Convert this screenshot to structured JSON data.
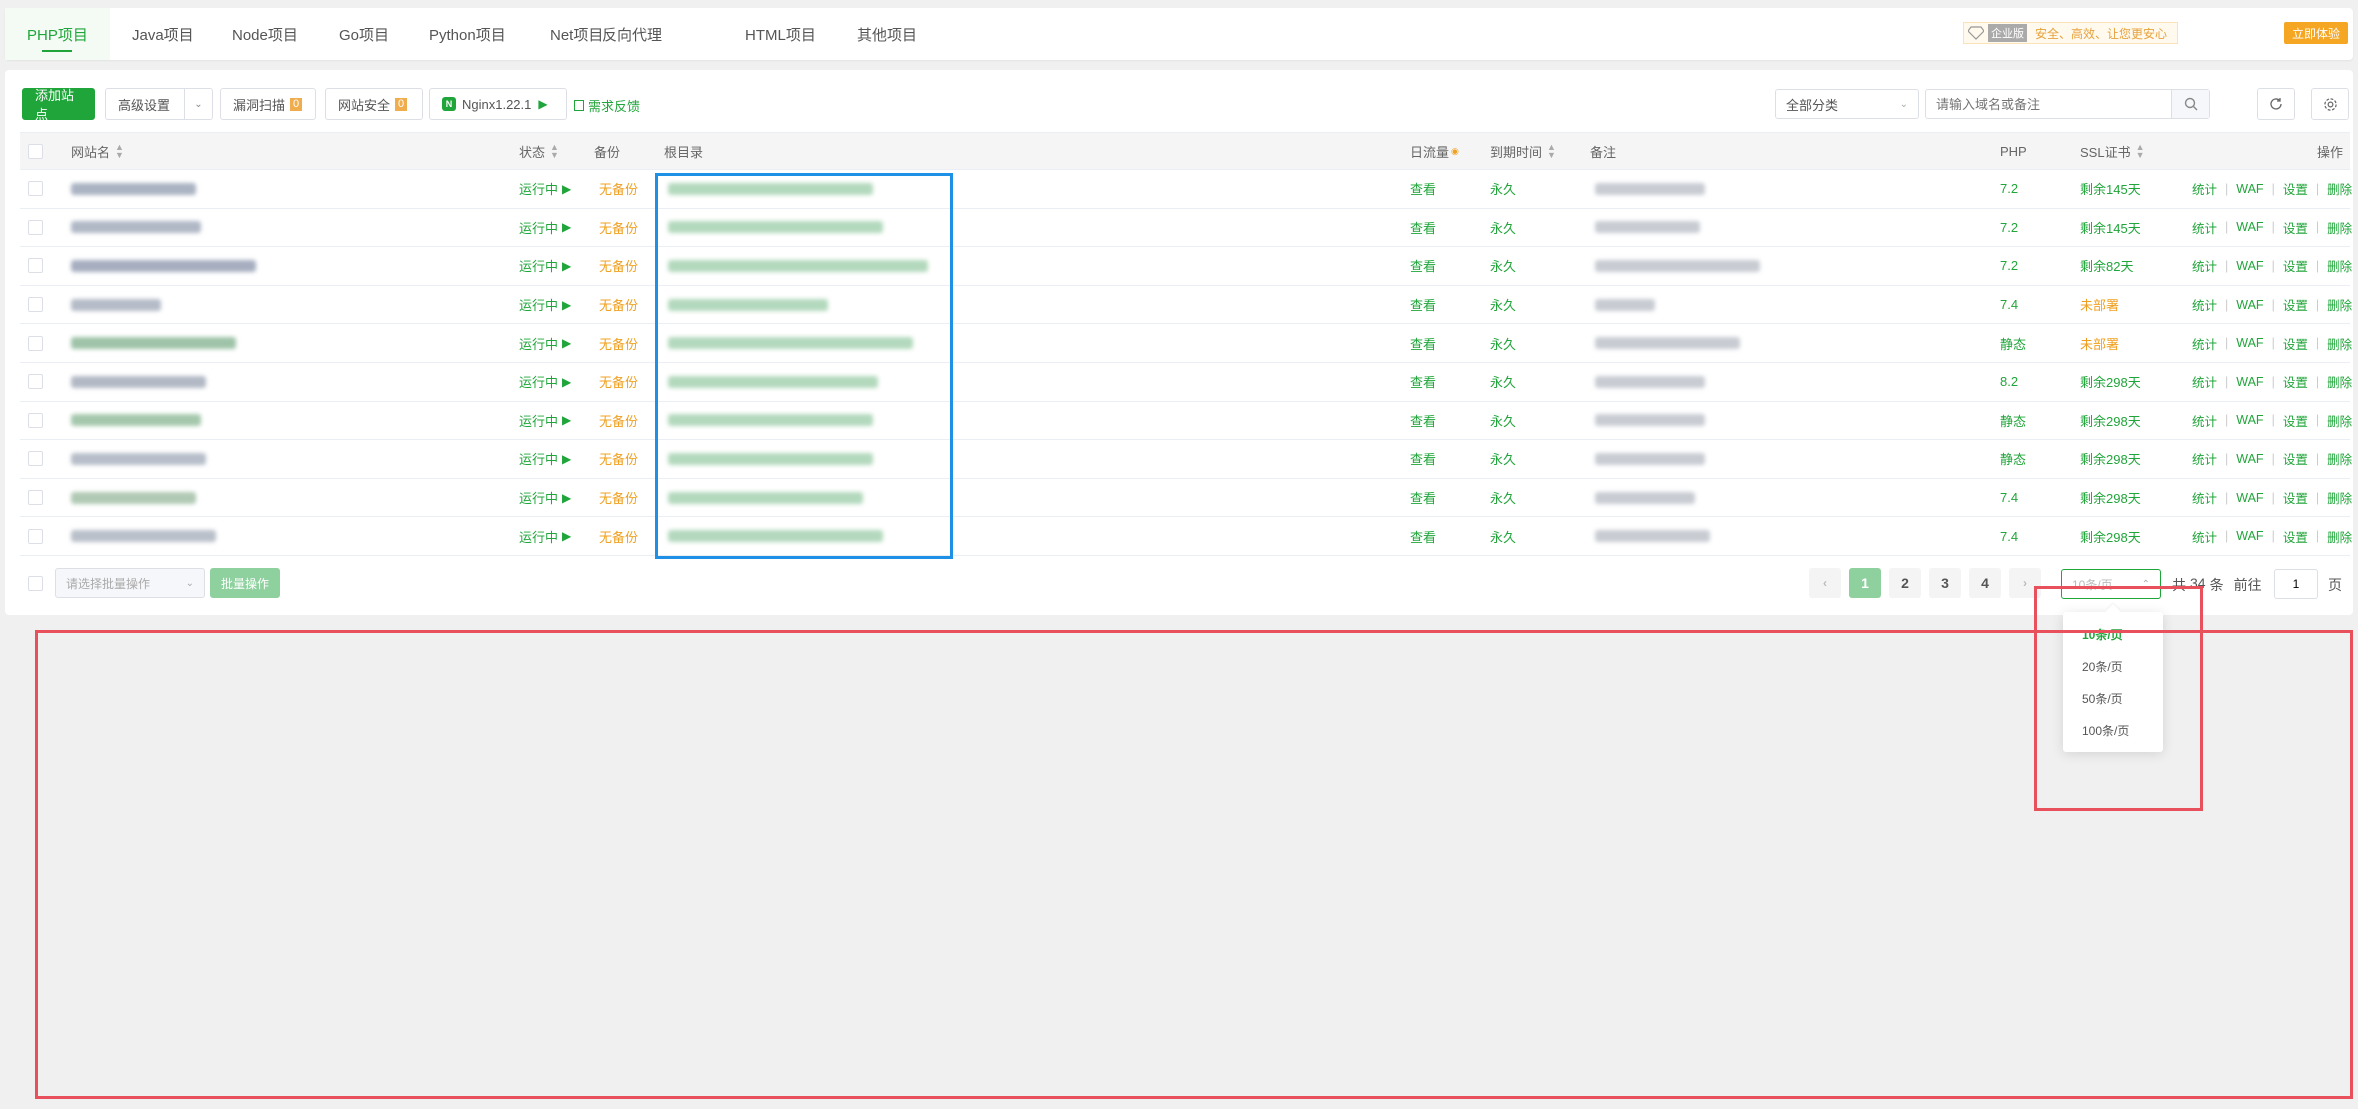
{
  "tabs": [
    "PHP项目",
    "Java项目",
    "Node项目",
    "Go项目",
    "Python项目",
    "Net项目",
    "反向代理",
    "HTML项目",
    "其他项目"
  ],
  "enterprise": {
    "badge": "企业版",
    "slogan": "安全、高效、让您更安心",
    "try_label": "立即体验"
  },
  "toolbar": {
    "add_site": "添加站点",
    "advanced": "高级设置",
    "vuln_scan": "漏洞扫描",
    "vuln_count": "0",
    "site_security": "网站安全",
    "security_count": "0",
    "nginx": "Nginx1.22.1",
    "feedback": "需求反馈",
    "category": "全部分类",
    "search_placeholder": "请输入域名或备注"
  },
  "columns": {
    "site": "网站名",
    "status": "状态",
    "backup": "备份",
    "root": "根目录",
    "traffic": "日流量",
    "expire": "到期时间",
    "note": "备注",
    "php": "PHP",
    "ssl": "SSL证书",
    "ops": "操作"
  },
  "row_labels": {
    "status": "运行中",
    "backup": "无备份",
    "traffic": "查看",
    "expire": "永久",
    "op_stats": "统计",
    "op_waf": "WAF",
    "op_settings": "设置",
    "op_delete": "删除"
  },
  "rows": [
    {
      "php": "7.2",
      "ssl": "剩余145天",
      "ssl_ok": true
    },
    {
      "php": "7.2",
      "ssl": "剩余145天",
      "ssl_ok": true
    },
    {
      "php": "7.2",
      "ssl": "剩余82天",
      "ssl_ok": true
    },
    {
      "php": "7.4",
      "ssl": "未部署",
      "ssl_ok": false
    },
    {
      "php": "静态",
      "ssl": "未部署",
      "ssl_ok": false
    },
    {
      "php": "8.2",
      "ssl": "剩余298天",
      "ssl_ok": true
    },
    {
      "php": "静态",
      "ssl": "剩余298天",
      "ssl_ok": true
    },
    {
      "php": "静态",
      "ssl": "剩余298天",
      "ssl_ok": true
    },
    {
      "php": "7.4",
      "ssl": "剩余298天",
      "ssl_ok": true
    },
    {
      "php": "7.4",
      "ssl": "剩余298天",
      "ssl_ok": true
    }
  ],
  "footer": {
    "batch_placeholder": "请选择批量操作",
    "batch_button": "批量操作",
    "pages": [
      "1",
      "2",
      "3",
      "4"
    ],
    "page_size": "10条/页",
    "total_prefix": "共",
    "total": "34",
    "total_suffix": "条",
    "goto": "前往",
    "goto_value": "1",
    "page_word": "页"
  },
  "page_size_options": [
    "10条/页",
    "20条/页",
    "50条/页",
    "100条/页"
  ],
  "colors": {
    "brand": "#20a53a",
    "warning": "#f0a020",
    "annotation_red": "#e8505b",
    "annotation_blue": "#1e90e6"
  }
}
